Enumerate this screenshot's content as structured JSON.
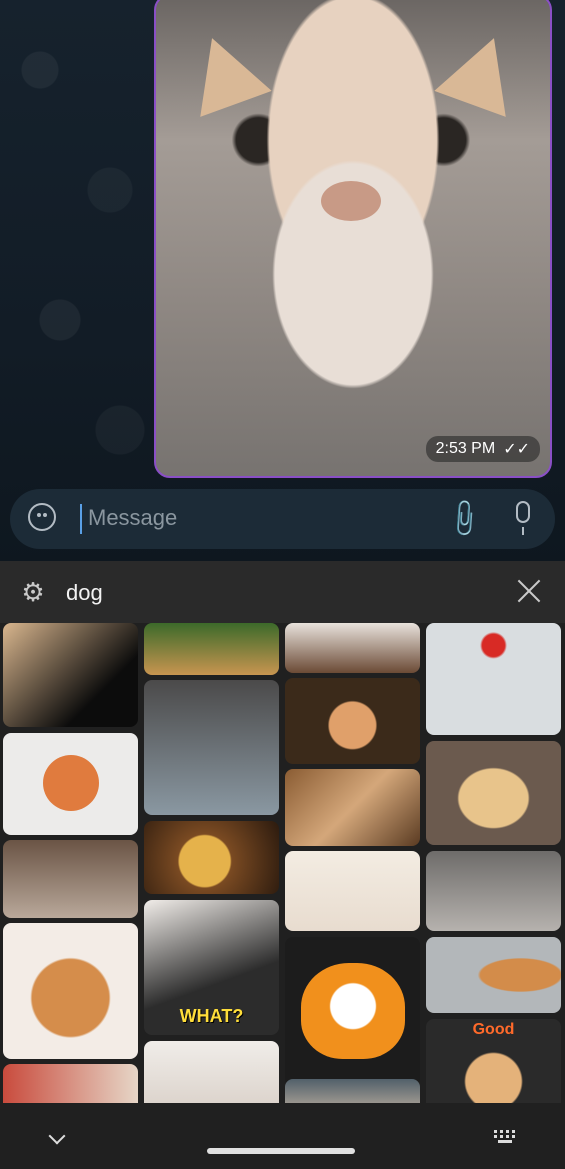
{
  "message": {
    "time": "2:53 PM",
    "status_icon": "double-check-icon"
  },
  "composer": {
    "placeholder": "Message",
    "emoji_icon": "emoji-icon",
    "attach_icon": "paperclip-icon",
    "mic_icon": "microphone-icon"
  },
  "gif_panel": {
    "query": "dog",
    "settings_icon": "gear-icon",
    "close_icon": "close-icon",
    "captions": {
      "what": "WHAT?",
      "good": "Good"
    }
  },
  "nav": {
    "collapse_icon": "chevron-down-icon",
    "keyboard_icon": "keyboard-icon"
  },
  "colors": {
    "bubble_border": "#8a4fc6",
    "accent_caret": "#5aa0e6",
    "panel_bg": "#202020"
  }
}
